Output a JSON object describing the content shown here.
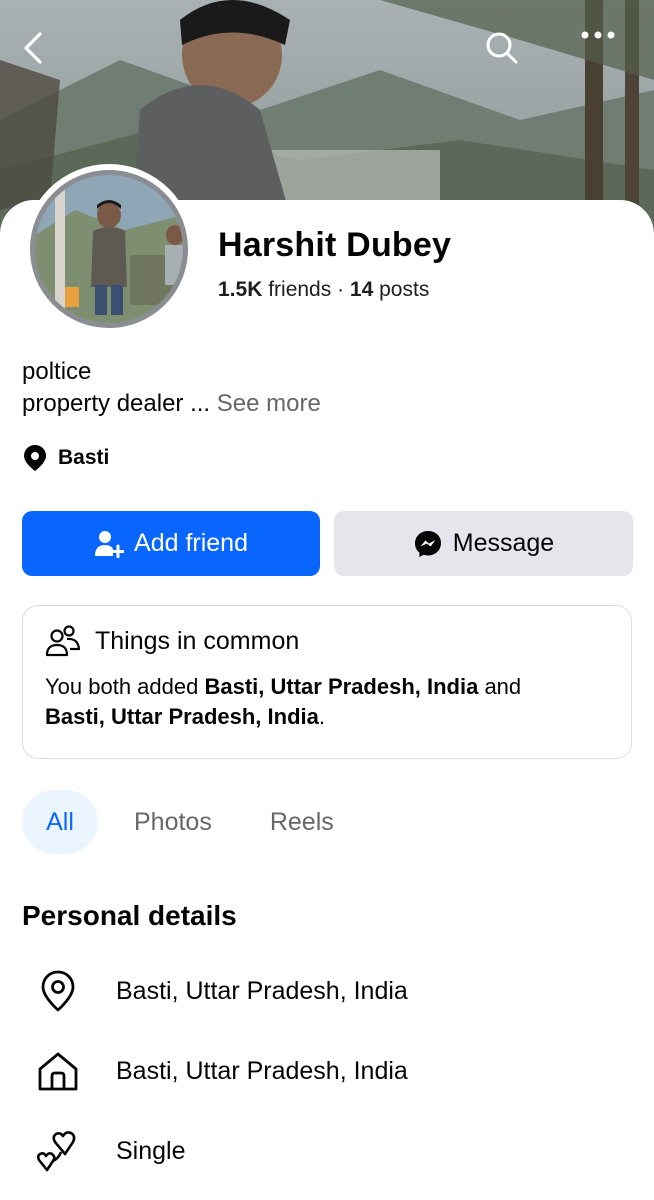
{
  "profile": {
    "name": "Harshit Dubey",
    "friends_count": "1.5K",
    "friends_label": "friends",
    "separator": "·",
    "posts_count": "14",
    "posts_label": "posts",
    "bio_line1": "poltice",
    "bio_line2": "property dealer ... ",
    "see_more": "See more",
    "location": "Basti"
  },
  "actions": {
    "add_friend": "Add friend",
    "message": "Message"
  },
  "common": {
    "title": "Things in common",
    "text_prefix": "You both added ",
    "place1": "Basti, Uttar Pradesh, India",
    "text_mid": " and",
    "place2": "Basti, Uttar Pradesh, India",
    "text_suffix": "."
  },
  "tabs": [
    "All",
    "Photos",
    "Reels"
  ],
  "personal_details": {
    "title": "Personal details",
    "current_city": "Basti, Uttar Pradesh, India",
    "hometown": "Basti, Uttar Pradesh, India",
    "relationship": "Single"
  },
  "icons": {
    "back": "chevron-left-icon",
    "search": "search-icon",
    "more": "more-dots-icon",
    "location": "location-pin-icon",
    "add_friend": "add-person-icon",
    "messenger": "messenger-icon",
    "people": "people-icon",
    "home": "home-icon",
    "relationship": "hearts-icon"
  },
  "colors": {
    "primary": "#0866ff",
    "secondary_button": "#e4e6eb",
    "muted_text": "#65676b",
    "active_tab_bg": "#ebf5ff"
  }
}
